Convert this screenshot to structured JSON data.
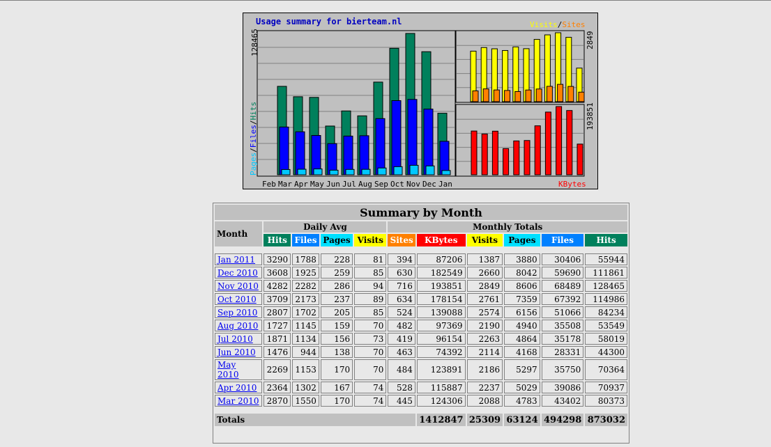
{
  "graph": {
    "title": "Usage summary for bierteam.nl",
    "months": [
      "Feb",
      "Mar",
      "Apr",
      "May",
      "Jun",
      "Jul",
      "Aug",
      "Sep",
      "Oct",
      "Nov",
      "Dec",
      "Jan"
    ],
    "left_max_label": "128465",
    "top_right_max_label": "2849",
    "bottom_right_max_label": "193851",
    "legend_pages": "Pages",
    "legend_files": "Files",
    "legend_hits": "Hits",
    "legend_visits": "Visits",
    "legend_sites": "Sites",
    "legend_kbytes": "KBytes",
    "slash": "/",
    "colors": {
      "hits": "#00805c",
      "files": "#0000ff",
      "pages": "#00c8ff",
      "visits": "#ffff00",
      "sites": "#ff8000",
      "kbytes": "#ff0000"
    }
  },
  "chart_data": [
    {
      "type": "bar",
      "categories": [
        "Feb",
        "Mar",
        "Apr",
        "May",
        "Jun",
        "Jul",
        "Aug",
        "Sep",
        "Oct",
        "Nov",
        "Dec",
        "Jan"
      ],
      "series": [
        {
          "name": "Hits",
          "values": [
            0,
            80373,
            70937,
            70364,
            44300,
            58019,
            53549,
            84234,
            114986,
            128465,
            111861,
            55944
          ]
        },
        {
          "name": "Files",
          "values": [
            0,
            43402,
            39086,
            35750,
            28331,
            35178,
            35508,
            51066,
            67392,
            68489,
            59690,
            30406
          ]
        },
        {
          "name": "Pages",
          "values": [
            0,
            4783,
            5029,
            5297,
            4168,
            4864,
            4940,
            6156,
            7359,
            8606,
            8042,
            3880
          ]
        }
      ],
      "ylim": [
        0,
        128465
      ]
    },
    {
      "type": "bar",
      "categories": [
        "Feb",
        "Mar",
        "Apr",
        "May",
        "Jun",
        "Jul",
        "Aug",
        "Sep",
        "Oct",
        "Nov",
        "Dec",
        "Jan"
      ],
      "series": [
        {
          "name": "Visits",
          "values": [
            0,
            2088,
            2237,
            2186,
            2114,
            2263,
            2190,
            2574,
            2761,
            2849,
            2660,
            1387
          ]
        },
        {
          "name": "Sites",
          "values": [
            0,
            445,
            528,
            484,
            463,
            419,
            482,
            524,
            634,
            716,
            630,
            394
          ]
        }
      ],
      "ylim": [
        0,
        2849
      ]
    },
    {
      "type": "bar",
      "categories": [
        "Feb",
        "Mar",
        "Apr",
        "May",
        "Jun",
        "Jul",
        "Aug",
        "Sep",
        "Oct",
        "Nov",
        "Dec",
        "Jan"
      ],
      "series": [
        {
          "name": "KBytes",
          "values": [
            0,
            124306,
            115887,
            123891,
            74392,
            96154,
            97369,
            139088,
            178154,
            193851,
            182549,
            87206
          ]
        }
      ],
      "ylim": [
        0,
        193851
      ]
    }
  ],
  "summary": {
    "title": "Summary by Month",
    "month_header": "Month",
    "daily_avg": "Daily Avg",
    "monthly_totals": "Monthly Totals",
    "col_hits": "Hits",
    "col_files": "Files",
    "col_pages": "Pages",
    "col_visits": "Visits",
    "col_sites": "Sites",
    "col_kbytes": "KBytes",
    "rows": [
      {
        "month": "Jan 2011",
        "d_hits": "3290",
        "d_files": "1788",
        "d_pages": "228",
        "d_visits": "81",
        "sites": "394",
        "kbytes": "87206",
        "visits": "1387",
        "pages": "3880",
        "files": "30406",
        "hits": "55944"
      },
      {
        "month": "Dec 2010",
        "d_hits": "3608",
        "d_files": "1925",
        "d_pages": "259",
        "d_visits": "85",
        "sites": "630",
        "kbytes": "182549",
        "visits": "2660",
        "pages": "8042",
        "files": "59690",
        "hits": "111861"
      },
      {
        "month": "Nov 2010",
        "d_hits": "4282",
        "d_files": "2282",
        "d_pages": "286",
        "d_visits": "94",
        "sites": "716",
        "kbytes": "193851",
        "visits": "2849",
        "pages": "8606",
        "files": "68489",
        "hits": "128465"
      },
      {
        "month": "Oct 2010",
        "d_hits": "3709",
        "d_files": "2173",
        "d_pages": "237",
        "d_visits": "89",
        "sites": "634",
        "kbytes": "178154",
        "visits": "2761",
        "pages": "7359",
        "files": "67392",
        "hits": "114986"
      },
      {
        "month": "Sep 2010",
        "d_hits": "2807",
        "d_files": "1702",
        "d_pages": "205",
        "d_visits": "85",
        "sites": "524",
        "kbytes": "139088",
        "visits": "2574",
        "pages": "6156",
        "files": "51066",
        "hits": "84234"
      },
      {
        "month": "Aug 2010",
        "d_hits": "1727",
        "d_files": "1145",
        "d_pages": "159",
        "d_visits": "70",
        "sites": "482",
        "kbytes": "97369",
        "visits": "2190",
        "pages": "4940",
        "files": "35508",
        "hits": "53549"
      },
      {
        "month": "Jul 2010",
        "d_hits": "1871",
        "d_files": "1134",
        "d_pages": "156",
        "d_visits": "73",
        "sites": "419",
        "kbytes": "96154",
        "visits": "2263",
        "pages": "4864",
        "files": "35178",
        "hits": "58019"
      },
      {
        "month": "Jun 2010",
        "d_hits": "1476",
        "d_files": "944",
        "d_pages": "138",
        "d_visits": "70",
        "sites": "463",
        "kbytes": "74392",
        "visits": "2114",
        "pages": "4168",
        "files": "28331",
        "hits": "44300"
      },
      {
        "month": "May 2010",
        "d_hits": "2269",
        "d_files": "1153",
        "d_pages": "170",
        "d_visits": "70",
        "sites": "484",
        "kbytes": "123891",
        "visits": "2186",
        "pages": "5297",
        "files": "35750",
        "hits": "70364"
      },
      {
        "month": "Apr 2010",
        "d_hits": "2364",
        "d_files": "1302",
        "d_pages": "167",
        "d_visits": "74",
        "sites": "528",
        "kbytes": "115887",
        "visits": "2237",
        "pages": "5029",
        "files": "39086",
        "hits": "70937"
      },
      {
        "month": "Mar 2010",
        "d_hits": "2870",
        "d_files": "1550",
        "d_pages": "170",
        "d_visits": "74",
        "sites": "445",
        "kbytes": "124306",
        "visits": "2088",
        "pages": "4783",
        "files": "43402",
        "hits": "80373"
      }
    ],
    "totals_label": "Totals",
    "totals": {
      "kbytes": "1412847",
      "visits": "25309",
      "pages": "63124",
      "files": "494298",
      "hits": "873032"
    }
  }
}
